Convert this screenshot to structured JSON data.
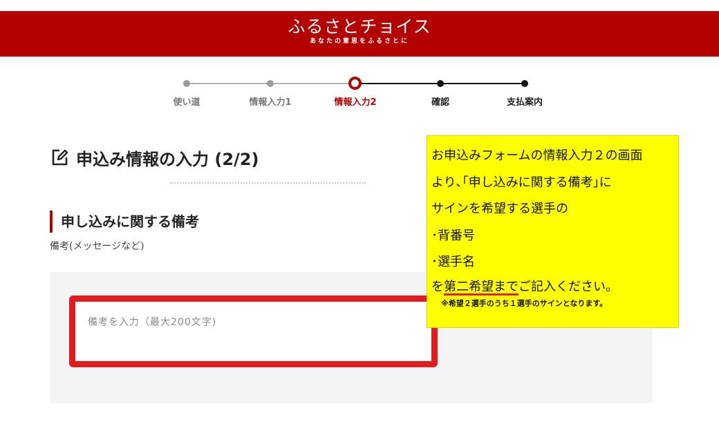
{
  "colors": {
    "brand": "#b30000",
    "highlight_border": "#e21c1c",
    "note_background": "#ffff00",
    "panel_background": "#f4f4f4"
  },
  "header": {
    "logo_main": "ふるさとチョイス",
    "logo_sub": "あなたの意思をふるさとに"
  },
  "steps": [
    {
      "label": "使い道",
      "state": "done"
    },
    {
      "label": "情報入力1",
      "state": "done"
    },
    {
      "label": "情報入力2",
      "state": "current"
    },
    {
      "label": "確認",
      "state": "upcoming"
    },
    {
      "label": "支払案内",
      "state": "upcoming"
    }
  ],
  "page": {
    "title_icon": "edit-icon",
    "title": "申込み情報の入力 (2/2)"
  },
  "section": {
    "heading": "申し込みに関する備考",
    "field_label": "備考(メッセージなど)",
    "placeholder": "備考を入力（最大200文字)",
    "value": ""
  },
  "note": {
    "lines": [
      "お申込みフォームの情報入力２の画面",
      "より､｢申し込みに関する備考｣に",
      "サインを希望する選手の",
      "･背番号",
      "･選手名"
    ],
    "last_prefix": "を",
    "last_underlined": "第二希望まで",
    "last_suffix": "ご記入ください。",
    "small": "※希望２選手のうち１選手のサインとなります。"
  }
}
